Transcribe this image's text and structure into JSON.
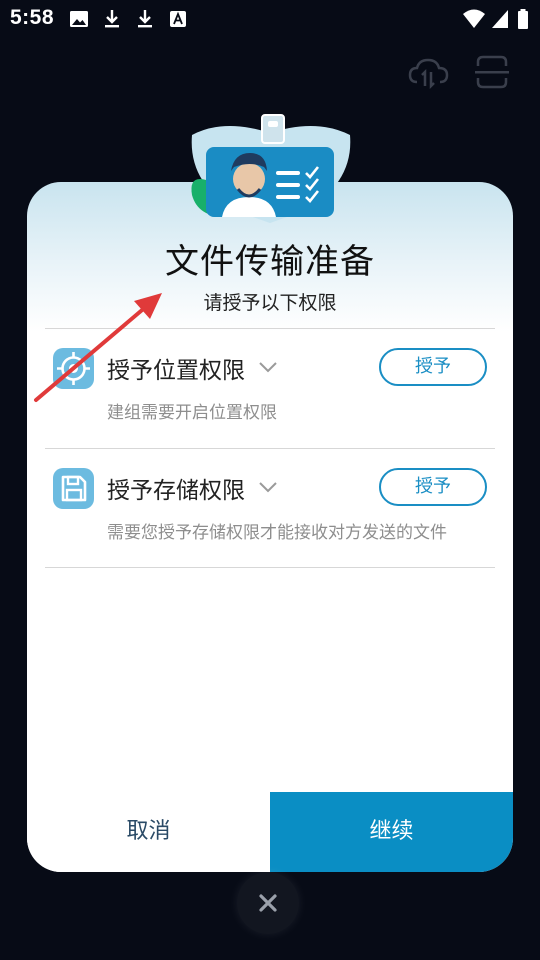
{
  "status_bar": {
    "time": "5:58",
    "icons": [
      "image-icon",
      "download-icon",
      "download-icon",
      "a-icon",
      "wifi-icon",
      "signal-icon",
      "battery-icon"
    ]
  },
  "background": {
    "icons": [
      "cloud-sync-icon",
      "scan-icon"
    ]
  },
  "dialog": {
    "title": "文件传输准备",
    "subtitle": "请授予以下权限",
    "permissions": [
      {
        "icon": "location-target-icon",
        "title": "授予位置权限",
        "description": "建组需要开启位置权限",
        "button": "授予"
      },
      {
        "icon": "save-disk-icon",
        "title": "授予存储权限",
        "description": "需要您授予存储权限才能接收对方发送的文件",
        "button": "授予"
      }
    ],
    "cancel_label": "取消",
    "continue_label": "继续"
  },
  "colors": {
    "accent": "#0a8ec4",
    "annotation_arrow": "#e03a3a"
  }
}
